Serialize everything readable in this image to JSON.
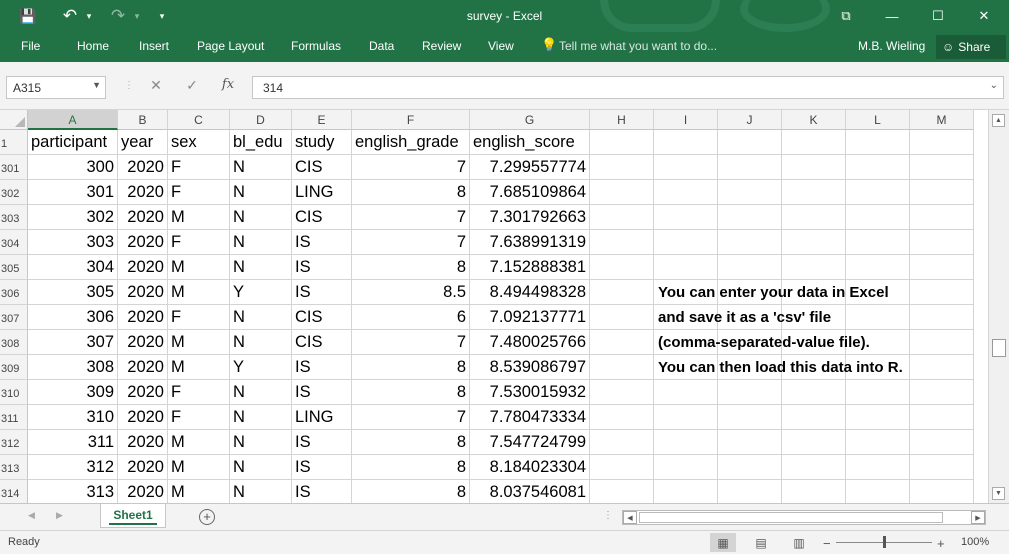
{
  "titlebar": {
    "title": "survey - Excel",
    "qa_save": "💾",
    "qa_undo": "↶",
    "qa_redo": "↷",
    "qa_more": "▾",
    "win_ribbon": "⧉",
    "win_min": "—",
    "win_max": "☐",
    "win_close": "✕"
  },
  "tabs": [
    "File",
    "Home",
    "Insert",
    "Page Layout",
    "Formulas",
    "Data",
    "Review",
    "View"
  ],
  "tellme": "Tell me what you want to do...",
  "user": "M.B. Wieling",
  "share": "Share",
  "namebox": "A315",
  "formula_value": "314",
  "fx_label": "fx",
  "columns": [
    "A",
    "B",
    "C",
    "D",
    "E",
    "F",
    "G",
    "H",
    "I",
    "J",
    "K",
    "L",
    "M"
  ],
  "header_row": {
    "num": "1",
    "cells": [
      "participant",
      "year",
      "sex",
      "bl_edu",
      "study",
      "english_grade",
      "english_score"
    ]
  },
  "rows": [
    {
      "num": "301",
      "cells": [
        "300",
        "2020",
        "F",
        "N",
        "CIS",
        "7",
        "7.299557774"
      ]
    },
    {
      "num": "302",
      "cells": [
        "301",
        "2020",
        "F",
        "N",
        "LING",
        "8",
        "7.685109864"
      ]
    },
    {
      "num": "303",
      "cells": [
        "302",
        "2020",
        "M",
        "N",
        "CIS",
        "7",
        "7.301792663"
      ]
    },
    {
      "num": "304",
      "cells": [
        "303",
        "2020",
        "F",
        "N",
        "IS",
        "7",
        "7.638991319"
      ]
    },
    {
      "num": "305",
      "cells": [
        "304",
        "2020",
        "M",
        "N",
        "IS",
        "8",
        "7.152888381"
      ]
    },
    {
      "num": "306",
      "cells": [
        "305",
        "2020",
        "M",
        "Y",
        "IS",
        "8.5",
        "8.494498328"
      ]
    },
    {
      "num": "307",
      "cells": [
        "306",
        "2020",
        "F",
        "N",
        "CIS",
        "6",
        "7.092137771"
      ]
    },
    {
      "num": "308",
      "cells": [
        "307",
        "2020",
        "M",
        "N",
        "CIS",
        "7",
        "7.480025766"
      ]
    },
    {
      "num": "309",
      "cells": [
        "308",
        "2020",
        "M",
        "Y",
        "IS",
        "8",
        "8.539086797"
      ]
    },
    {
      "num": "310",
      "cells": [
        "309",
        "2020",
        "F",
        "N",
        "IS",
        "8",
        "7.530015932"
      ]
    },
    {
      "num": "311",
      "cells": [
        "310",
        "2020",
        "F",
        "N",
        "LING",
        "7",
        "7.780473334"
      ]
    },
    {
      "num": "312",
      "cells": [
        "311",
        "2020",
        "M",
        "N",
        "IS",
        "8",
        "7.547724799"
      ]
    },
    {
      "num": "313",
      "cells": [
        "312",
        "2020",
        "M",
        "N",
        "IS",
        "8",
        "8.184023304"
      ]
    },
    {
      "num": "314",
      "cells": [
        "313",
        "2020",
        "M",
        "N",
        "IS",
        "8",
        "8.037546081"
      ]
    }
  ],
  "note_lines": [
    "You can enter your data in Excel",
    "and save it as a 'csv' file",
    "(comma-separated-value file).",
    "You can then load this data into R."
  ],
  "sheet_tab": "Sheet1",
  "status": {
    "ready": "Ready",
    "zoom": "100%"
  },
  "colors": {
    "accent": "#217346"
  }
}
